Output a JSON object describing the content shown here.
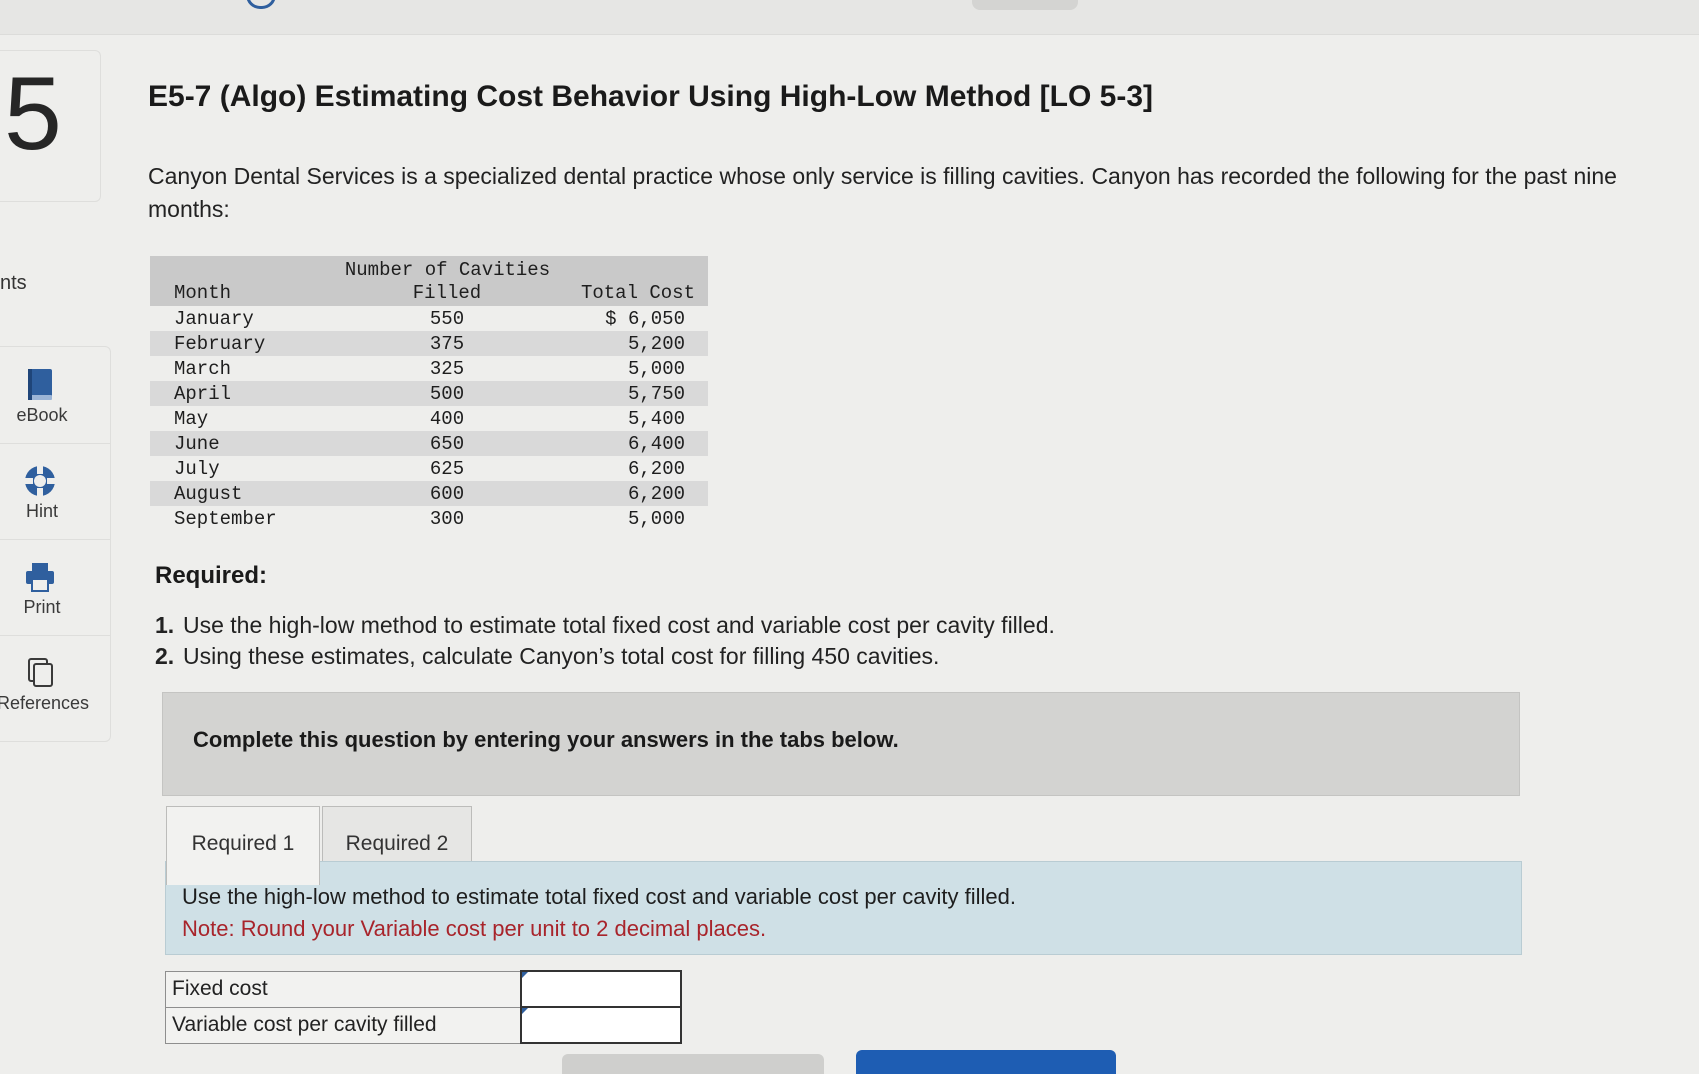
{
  "question_number": "5",
  "points_label": "nts",
  "sidebar": {
    "items": [
      {
        "label": "eBook"
      },
      {
        "label": "Hint"
      },
      {
        "label": "Print"
      },
      {
        "label": "References"
      }
    ]
  },
  "title": "E5-7 (Algo) Estimating Cost Behavior Using High-Low Method [LO 5-3]",
  "intro": "Canyon Dental Services is a specialized dental practice whose only service is filling cavities. Canyon has recorded the following for the past nine months:",
  "table": {
    "header_month": "Month",
    "header_filled_line1": "Number of Cavities",
    "header_filled_line2": "Filled",
    "header_cost": "Total Cost",
    "rows": [
      {
        "month": "January",
        "filled": "550",
        "cost": "$ 6,050"
      },
      {
        "month": "February",
        "filled": "375",
        "cost": "5,200"
      },
      {
        "month": "March",
        "filled": "325",
        "cost": "5,000"
      },
      {
        "month": "April",
        "filled": "500",
        "cost": "5,750"
      },
      {
        "month": "May",
        "filled": "400",
        "cost": "5,400"
      },
      {
        "month": "June",
        "filled": "650",
        "cost": "6,400"
      },
      {
        "month": "July",
        "filled": "625",
        "cost": "6,200"
      },
      {
        "month": "August",
        "filled": "600",
        "cost": "6,200"
      },
      {
        "month": "September",
        "filled": "300",
        "cost": "5,000"
      }
    ]
  },
  "required": {
    "heading": "Required:",
    "items": [
      {
        "num": "1.",
        "text": "Use the high-low method to estimate total fixed cost and variable cost per cavity filled."
      },
      {
        "num": "2.",
        "text": "Using these estimates, calculate Canyon’s total cost for filling 450 cavities."
      }
    ]
  },
  "banner": "Complete this question by entering your answers in the tabs below.",
  "tabs": [
    {
      "label": "Required 1",
      "active": true
    },
    {
      "label": "Required 2",
      "active": false
    }
  ],
  "instructions": {
    "line1": "Use the high-low method to estimate total fixed cost and variable cost per cavity filled.",
    "note": "Note: Round your Variable cost per unit to 2 decimal places."
  },
  "answers": [
    {
      "label": "Fixed cost",
      "value": ""
    },
    {
      "label": "Variable cost per cavity filled",
      "value": ""
    }
  ],
  "colors": {
    "accent": "#1e5db3",
    "note_red": "#a8242b",
    "instruction_bg": "#cfe0e6"
  }
}
